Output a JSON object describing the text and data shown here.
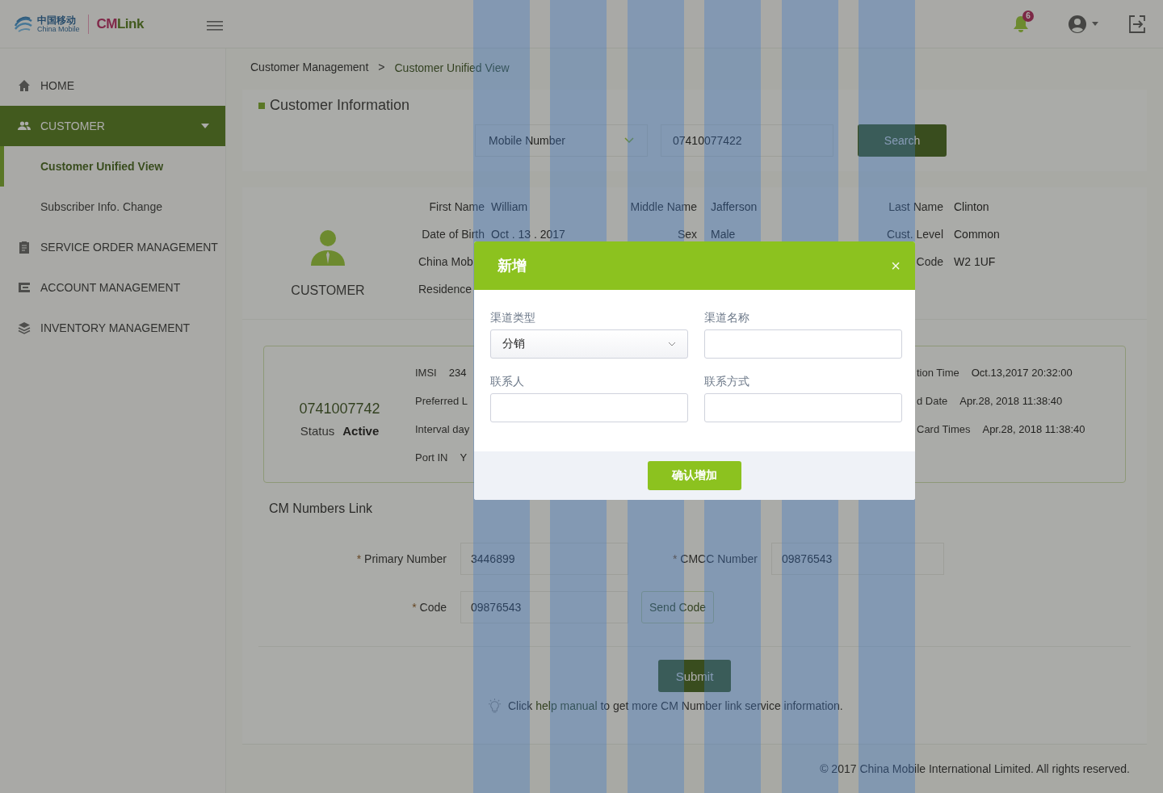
{
  "header": {
    "logo": {
      "name_cn": "中国移动",
      "name_en": "China Mobile",
      "brand_prefix": "CM",
      "brand_suffix": "Link"
    },
    "notifications": {
      "badge": "6"
    }
  },
  "sidebar": {
    "items": [
      {
        "label": "HOME",
        "selected": false
      },
      {
        "label": "CUSTOMER",
        "selected": true,
        "expanded": true,
        "children": [
          {
            "label": "Customer Unified View",
            "selected": true
          },
          {
            "label": "Subscriber Info. Change",
            "selected": false
          }
        ]
      },
      {
        "label": "SERVICE ORDER MANAGEMENT",
        "selected": false
      },
      {
        "label": "ACCOUNT MANAGEMENT",
        "selected": false
      },
      {
        "label": "INVENTORY MANAGEMENT",
        "selected": false
      }
    ]
  },
  "breadcrumb": {
    "items": [
      "Customer Management",
      "Customer Unified View"
    ],
    "separator": ">"
  },
  "customer_information": {
    "title": "Customer Information",
    "search": {
      "type": "Mobile Number",
      "value": "07410077422",
      "button": "Search"
    }
  },
  "profile": {
    "avatar_label": "CUSTOMER",
    "columns": [
      {
        "rows": [
          {
            "label": "First Name",
            "value": "William"
          },
          {
            "label": "Date of Birth",
            "value": "Oct . 13 . 2017"
          },
          {
            "label": "China Mob"
          },
          {
            "label": "Residence"
          }
        ]
      },
      {
        "rows": [
          {
            "label": "Middle Name",
            "value": "Jafferson"
          },
          {
            "label": "Sex",
            "value": "Male"
          }
        ]
      },
      {
        "rows": [
          {
            "label": "Last Name",
            "value": "Clinton"
          },
          {
            "label": "Cust. Level",
            "value": "Common"
          },
          {
            "label": "Code",
            "value": "W2 1UF"
          }
        ]
      }
    ]
  },
  "number_card": {
    "number": "0741007742",
    "status_label": "Status",
    "status": "Active",
    "left_rows": [
      {
        "label": "IMSI",
        "value": "234"
      },
      {
        "label": "Preferred L"
      },
      {
        "label": "Interval day"
      },
      {
        "label": "Port IN",
        "value": "Y"
      }
    ],
    "right_rows": [
      {
        "label": "tion Time",
        "value": "Oct.13,2017 20:32:00"
      },
      {
        "label": "d Date",
        "value": "Apr.28, 2018 11:38:40"
      },
      {
        "label": "Card Times",
        "value": "Apr.28, 2018 11:38:40"
      }
    ]
  },
  "cm_numbers_link": {
    "title": "CM Numbers Link",
    "fields": [
      {
        "marker": "*",
        "label": "Primary Number",
        "value": "3446899"
      },
      {
        "marker": "*",
        "label": "CMCC Number",
        "value": "09876543"
      },
      {
        "marker": "*",
        "label": "Code",
        "value": "09876543"
      }
    ],
    "send_code": "Send Code",
    "submit": "Submit",
    "hint": {
      "before": "Click",
      "link": "help manual",
      "after": "to get more CM Number link service information."
    }
  },
  "footer": {
    "copyright": "© 2017 China Mobile International Limited. All rights reserved."
  },
  "dialog": {
    "title": "新增",
    "close": "×",
    "fields": [
      {
        "label": "渠道类型",
        "kind": "select",
        "value": "分销"
      },
      {
        "label": "渠道名称",
        "kind": "input"
      },
      {
        "label": "联系人",
        "kind": "input"
      },
      {
        "label": "联系方式",
        "kind": "input"
      }
    ],
    "confirm": "确认增加"
  }
}
